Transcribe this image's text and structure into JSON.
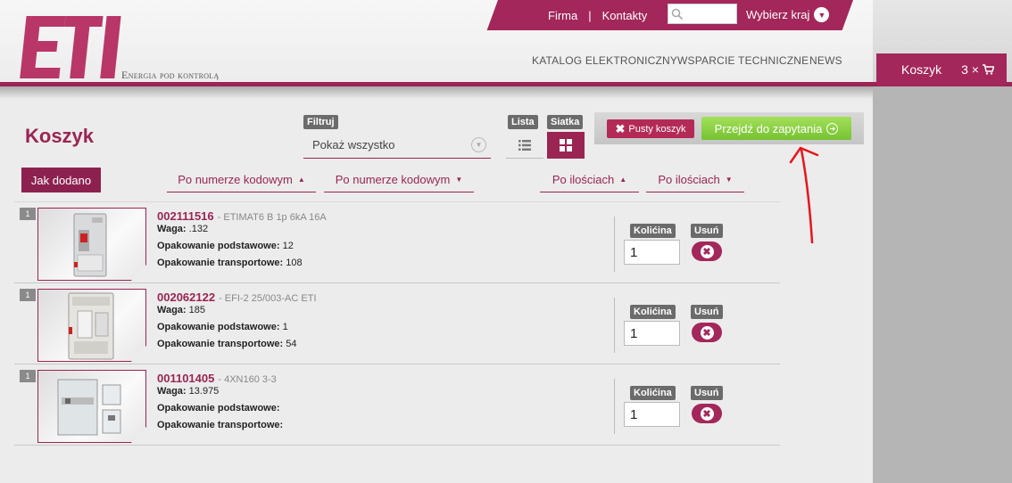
{
  "brand": {
    "logo_text": "ETI",
    "tagline": "Energia pod kontrolą",
    "color": "#a3275a"
  },
  "topbar": {
    "link_firma": "Firma",
    "separator": "|",
    "link_kontakty": "Kontakty",
    "search_placeholder": "",
    "country_label": "Wybierz kraj"
  },
  "nav": {
    "catalog": "KATALOG ELEKTRONICZNY",
    "support": "WSPARCIE TECHNICZNE",
    "news": "NEWS"
  },
  "cart_tab": {
    "label": "Koszyk",
    "count": "3 ×"
  },
  "page": {
    "title": "Koszyk"
  },
  "filter": {
    "label": "Filtruj",
    "selected": "Pokaż wszystko"
  },
  "view": {
    "list_label": "Lista",
    "grid_label": "Siatka",
    "active": "grid"
  },
  "actions": {
    "empty_label": "Pusty koszyk",
    "go_label": "Przejdź do zapytania"
  },
  "sorting": {
    "as_added": "Jak dodano",
    "code_asc": "Po numerze kodowym",
    "code_desc": "Po numerze kodowym",
    "qty_asc": "Po ilościach",
    "qty_desc": "Po ilościach"
  },
  "columns": {
    "quantity": "Kolićina",
    "remove": "Usuń"
  },
  "labels": {
    "weight": "Waga:",
    "basic_pack": "Opakowanie podstawowe:",
    "transport_pack": "Opakowanie transportowe:"
  },
  "items": [
    {
      "index": "1",
      "code": "002111516",
      "desc": "- ETIMAT6 B 1p 6kA 16A",
      "weight": ".132",
      "basic_pack": "12",
      "transport_pack": "108",
      "quantity": "1"
    },
    {
      "index": "1",
      "code": "002062122",
      "desc": "- EFI-2 25/003-AC ETI",
      "weight": "185",
      "basic_pack": "1",
      "transport_pack": "54",
      "quantity": "1"
    },
    {
      "index": "1",
      "code": "001101405",
      "desc": "- 4XN160 3-3",
      "weight": "13.975",
      "basic_pack": "",
      "transport_pack": "",
      "quantity": "1"
    }
  ],
  "colors": {
    "accent": "#a3275a",
    "go_button": "#86cf3f",
    "annotation": "#e8141c"
  }
}
